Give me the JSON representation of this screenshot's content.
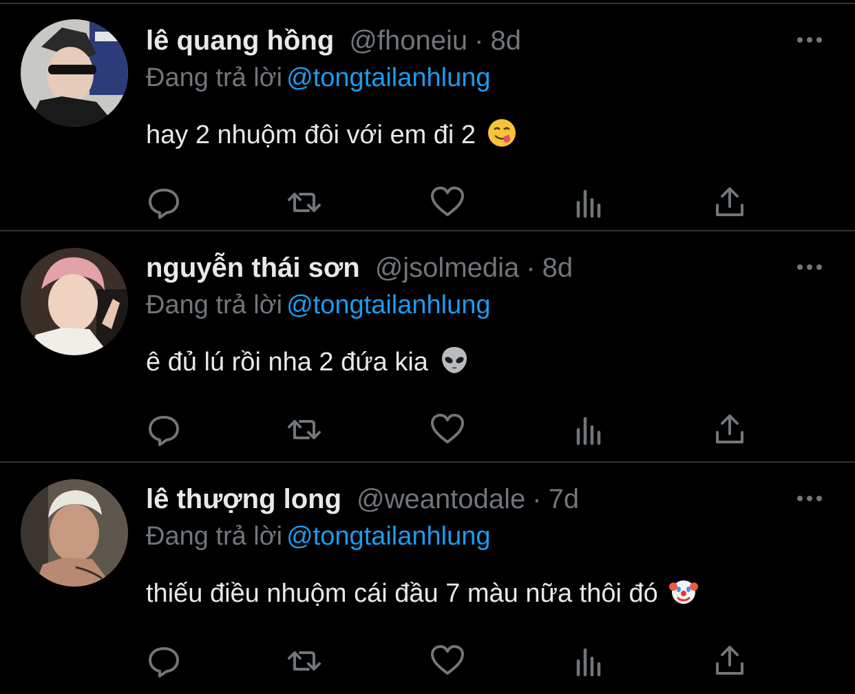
{
  "colors": {
    "background": "#000000",
    "name": "#e7e9ea",
    "secondary": "#71767b",
    "mention": "#1d9bf0",
    "divider": "#2f3336"
  },
  "tweets": [
    {
      "name": "lê quang hồng",
      "handle": "@fhoneiu",
      "separator": "·",
      "time": "8d",
      "reply_prefix": "Đang trả lời",
      "reply_to": "@tongtailanhlung",
      "text": "hay 2 nhuộm đôi với em đi 2",
      "emoji": "face-savoring-food-emoji",
      "avatar": "avatar-lê-quang-hồng"
    },
    {
      "name": "nguyễn thái sơn",
      "handle": "@jsolmedia",
      "separator": "·",
      "time": "8d",
      "reply_prefix": "Đang trả lời",
      "reply_to": "@tongtailanhlung",
      "text": "ê đủ lú rồi nha 2 đứa kia",
      "emoji": "alien-emoji",
      "avatar": "avatar-nguyễn-thái-sơn"
    },
    {
      "name": "lê thượng long",
      "handle": "@weantodale",
      "separator": "·",
      "time": "7d",
      "reply_prefix": "Đang trả lời",
      "reply_to": "@tongtailanhlung",
      "text": "thiếu điều nhuộm cái đầu 7 màu nữa thôi đó",
      "emoji": "clown-face-emoji",
      "avatar": "avatar-lê-thượng-long"
    }
  ],
  "actions": [
    "reply-icon",
    "retweet-icon",
    "like-icon",
    "analytics-icon",
    "share-icon"
  ]
}
